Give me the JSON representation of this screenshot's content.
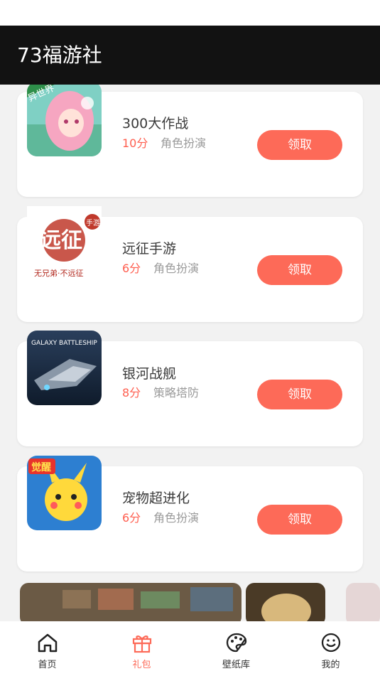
{
  "app": {
    "title": "73福游社"
  },
  "games": [
    {
      "name": "300大作战",
      "score": "10分",
      "category": "角色扮演",
      "button": "领取",
      "icon_text": "异世界"
    },
    {
      "name": "远征手游",
      "score": "6分",
      "category": "角色扮演",
      "button": "领取",
      "icon_text": "远征",
      "icon_sub": "无兄弟·不远征",
      "icon_tag": "手游"
    },
    {
      "name": "银河战舰",
      "score": "8分",
      "category": "策略塔防",
      "button": "领取",
      "icon_text": "GALAXY BATTLESHIP"
    },
    {
      "name": "宠物超进化",
      "score": "6分",
      "category": "角色扮演",
      "button": "领取",
      "icon_text": "觉醒"
    }
  ],
  "nav": [
    {
      "label": "首页",
      "icon": "home-icon"
    },
    {
      "label": "礼包",
      "icon": "gift-icon",
      "active": true
    },
    {
      "label": "壁纸库",
      "icon": "palette-icon"
    },
    {
      "label": "我的",
      "icon": "smile-icon"
    }
  ],
  "colors": {
    "accent": "#fd6a58",
    "score": "#ff5e4f",
    "appbar": "#121212"
  }
}
